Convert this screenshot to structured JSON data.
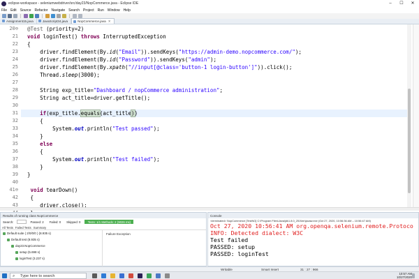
{
  "window": {
    "title": "eclipse-workspace - seleniumwebdriver/src/day23/NopCommerce.java - Eclipse IDE",
    "controls": [
      "–",
      "☐",
      "✕"
    ]
  },
  "menu": [
    "File",
    "Edit",
    "Source",
    "Refactor",
    "Navigate",
    "Search",
    "Project",
    "Run",
    "Window",
    "Help"
  ],
  "tabs": [
    {
      "label": "Assignment15.java",
      "active": false
    },
    {
      "label": "JavaScript34.java",
      "active": false
    },
    {
      "label": "NopCommerce.java",
      "active": true
    }
  ],
  "editor": {
    "current_line": 31,
    "lines": [
      {
        "num": "20",
        "marker": "⊖",
        "parts": [
          {
            "t": "  "
          },
          {
            "t": "@Test",
            "c": "ann"
          },
          {
            "t": " (priority=2)"
          }
        ]
      },
      {
        "num": "21",
        "parts": [
          {
            "t": "  "
          },
          {
            "t": "void",
            "c": "kw"
          },
          {
            "t": " loginTest() "
          },
          {
            "t": "throws",
            "c": "kw"
          },
          {
            "t": " InterruptedException"
          }
        ]
      },
      {
        "num": "22",
        "parts": [
          {
            "t": "  {"
          }
        ]
      },
      {
        "num": "23",
        "parts": [
          {
            "t": "      driver.findElement(By."
          },
          {
            "t": "id",
            "c": "itl"
          },
          {
            "t": "("
          },
          {
            "t": "\"Email\"",
            "c": "str"
          },
          {
            "t": ")).sendKeys("
          },
          {
            "t": "\"https://admin-demo.nopcommerce.com/\"",
            "c": "str"
          },
          {
            "t": ");"
          }
        ]
      },
      {
        "num": "24",
        "parts": [
          {
            "t": "      driver.findElement(By."
          },
          {
            "t": "id",
            "c": "itl"
          },
          {
            "t": "("
          },
          {
            "t": "\"Password\"",
            "c": "str"
          },
          {
            "t": ")).sendKeys("
          },
          {
            "t": "\"admin\"",
            "c": "str"
          },
          {
            "t": ");"
          }
        ]
      },
      {
        "num": "25",
        "parts": [
          {
            "t": "      driver.findElement(By."
          },
          {
            "t": "xpath",
            "c": "itl"
          },
          {
            "t": "("
          },
          {
            "t": "\"//input[@class='button-1 login-button']\"",
            "c": "str"
          },
          {
            "t": ")).click();"
          }
        ]
      },
      {
        "num": "26",
        "parts": [
          {
            "t": "      Thread."
          },
          {
            "t": "sleep",
            "c": "itl"
          },
          {
            "t": "(3000);"
          }
        ]
      },
      {
        "num": "27",
        "parts": []
      },
      {
        "num": "28",
        "parts": [
          {
            "t": "      String exp_title="
          },
          {
            "t": "\"Dashboard / nopCommerce administration\"",
            "c": "str"
          },
          {
            "t": ";"
          }
        ]
      },
      {
        "num": "29",
        "parts": [
          {
            "t": "      String act_title=driver.getTitle();"
          }
        ]
      },
      {
        "num": "30",
        "parts": []
      },
      {
        "num": "31",
        "parts": [
          {
            "t": "      "
          },
          {
            "t": "if",
            "c": "kw"
          },
          {
            "t": "(exp_title."
          },
          {
            "t": "equals",
            "c": "match"
          },
          {
            "t": "(act_title"
          },
          {
            "t": ")",
            "c": "match"
          },
          {
            "t": ")"
          }
        ]
      },
      {
        "num": "32",
        "parts": [
          {
            "t": "      {"
          }
        ]
      },
      {
        "num": "33",
        "parts": [
          {
            "t": "          System."
          },
          {
            "t": "out",
            "c": "fld"
          },
          {
            "t": ".println("
          },
          {
            "t": "\"Test passed\"",
            "c": "str"
          },
          {
            "t": ");"
          }
        ]
      },
      {
        "num": "34",
        "parts": [
          {
            "t": "      }"
          }
        ]
      },
      {
        "num": "35",
        "parts": [
          {
            "t": "      "
          },
          {
            "t": "else",
            "c": "kw"
          }
        ]
      },
      {
        "num": "36",
        "parts": [
          {
            "t": "      {"
          }
        ]
      },
      {
        "num": "37",
        "parts": [
          {
            "t": "          System."
          },
          {
            "t": "out",
            "c": "fld"
          },
          {
            "t": ".println("
          },
          {
            "t": "\"Test failed\"",
            "c": "str"
          },
          {
            "t": ");"
          }
        ]
      },
      {
        "num": "38",
        "parts": [
          {
            "t": "      }"
          }
        ]
      },
      {
        "num": "39",
        "parts": [
          {
            "t": "  }"
          }
        ]
      },
      {
        "num": "40",
        "parts": []
      },
      {
        "num": "41",
        "marker": "⊖",
        "parts": [
          {
            "t": "   "
          },
          {
            "t": "void",
            "c": "kw"
          },
          {
            "t": " tearDown()"
          }
        ]
      },
      {
        "num": "42",
        "parts": [
          {
            "t": "   {"
          }
        ]
      },
      {
        "num": "43",
        "parts": [
          {
            "t": "      driver.close();"
          }
        ]
      },
      {
        "num": "44",
        "parts": [
          {
            "t": "   }"
          }
        ]
      },
      {
        "num": "45",
        "parts": [
          {
            "t": "}"
          }
        ]
      },
      {
        "num": "46",
        "parts": []
      }
    ]
  },
  "test_panel": {
    "title": "Results of running class NopCommerce",
    "search_label": "Search:",
    "passed": "Passed: 2",
    "failed": "Failed: 0",
    "skipped": "Skipped: 0",
    "summary": "Tests: 1/1  Methods: 2 (9026 ms)",
    "sub_tabs": [
      "All Tests",
      "Failed Tests",
      "Summary"
    ],
    "tree": [
      "Default suite ( 2/0/0/0 ) (8.935 s)",
      "Default test (8.935 s)",
      "day23.NopCommerce",
      "setup (5.698 s)",
      "loginTest (3.237 s)"
    ],
    "failure_label": "Failure Exception"
  },
  "console": {
    "title": "Console",
    "status": "<terminated> NopCommerce [TestNG] C:\\Program Files\\Java\\jdk1.8.0_251\\bin\\javaw.exe (Oct 27, 2020, 10:56:36 AM – 10:56:47 AM)",
    "lines": [
      {
        "text": "Oct 27, 2020 10:56:41 AM org.openqa.selenium.remote.Protoco",
        "color": "#e02020"
      },
      {
        "text": "INFO: Detected dialect: W3C",
        "color": "#e02020"
      },
      {
        "text": "Test failed",
        "color": "#000000"
      },
      {
        "text": "PASSED: setup",
        "color": "#000000"
      },
      {
        "text": "PASSED: loginTest",
        "color": "#000000"
      }
    ]
  },
  "statusbar": {
    "mode": "Writable",
    "insert": "Smart Insert",
    "position": "31 : 27 : 966"
  },
  "taskbar": {
    "search_placeholder": "Type here to search",
    "time": "10:57 AM",
    "date": "10/27/2020"
  }
}
